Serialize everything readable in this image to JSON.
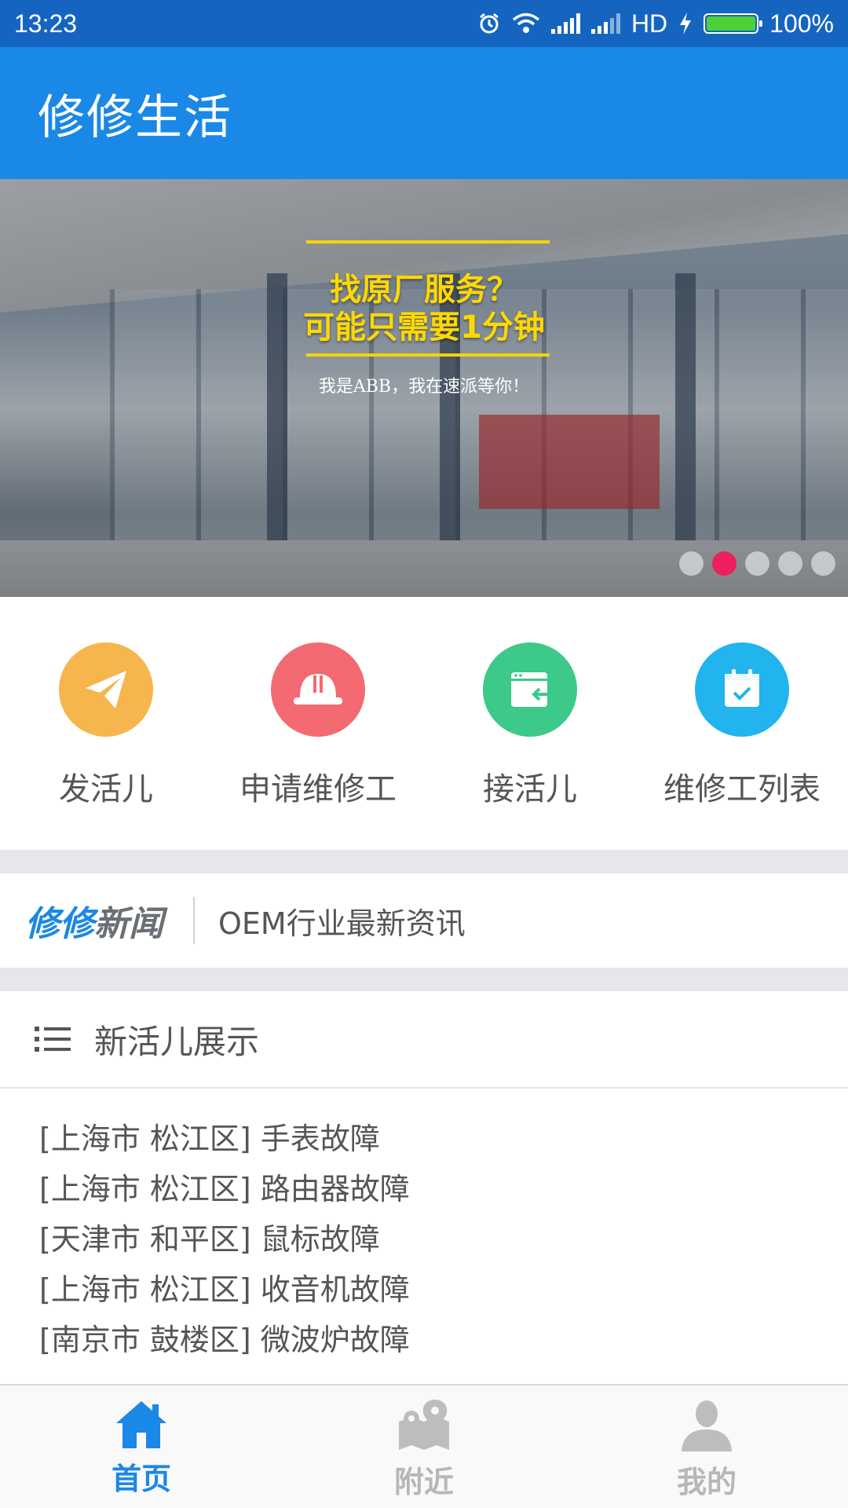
{
  "status_bar": {
    "time": "13:23",
    "network": "HD",
    "battery": "100%"
  },
  "app_bar": {
    "title": "修修生活"
  },
  "banner": {
    "headline_1": "找原厂服务？",
    "headline_2": "可能只需要1分钟",
    "subline": "我是ABB，我在速派等你！",
    "slide_count": 5,
    "active_slide": 2
  },
  "quick_actions": [
    {
      "label": "发活儿",
      "color": "#f7b54d",
      "icon": "paper-plane-icon"
    },
    {
      "label": "申请维修工",
      "color": "#f36a72",
      "icon": "hard-hat-icon"
    },
    {
      "label": "接活儿",
      "color": "#3cc98a",
      "icon": "inbox-icon"
    },
    {
      "label": "维修工列表",
      "color": "#21b4ee",
      "icon": "calendar-icon"
    }
  ],
  "news": {
    "brand_part1": "修修",
    "brand_part2": "新闻",
    "text": "OEM行业最新资讯"
  },
  "job_list": {
    "title": "新活儿展示",
    "items": [
      "[上海市 松江区]  手表故障",
      "[上海市 松江区]  路由器故障",
      "[天津市 和平区]  鼠标故障",
      "[上海市 松江区]  收音机故障",
      "[南京市 鼓楼区]  微波炉故障"
    ]
  },
  "tabs": [
    {
      "label": "首页",
      "icon": "home-icon",
      "active": true
    },
    {
      "label": "附近",
      "icon": "map-pin-icon",
      "active": false
    },
    {
      "label": "我的",
      "icon": "user-icon",
      "active": false
    }
  ],
  "colors": {
    "primary": "#1a88e6",
    "status_bar": "#1565c0",
    "indicator_active": "#ef1f5d"
  }
}
